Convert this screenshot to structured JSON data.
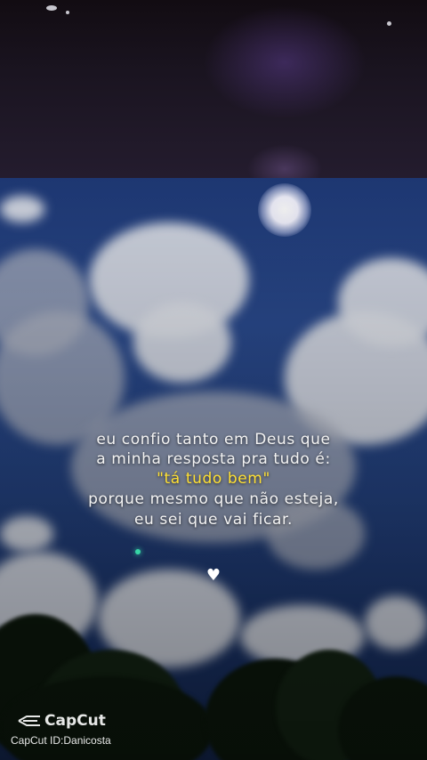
{
  "quote": {
    "line1": "eu confio tanto em Deus que",
    "line2": "a minha resposta pra tudo é:",
    "line3": "\"tá  tudo bem\"",
    "line4": "porque mesmo que não esteja,",
    "line5": "eu sei que vai ficar."
  },
  "watermark": {
    "brand": "CapCut",
    "id": "CapCut ID:Danicosta",
    "icon": "capcut-logo-icon"
  },
  "decorations": {
    "heart_icon": "heart-icon",
    "highlight_color": "#ffe033",
    "text_color": "#f3f3f3"
  }
}
